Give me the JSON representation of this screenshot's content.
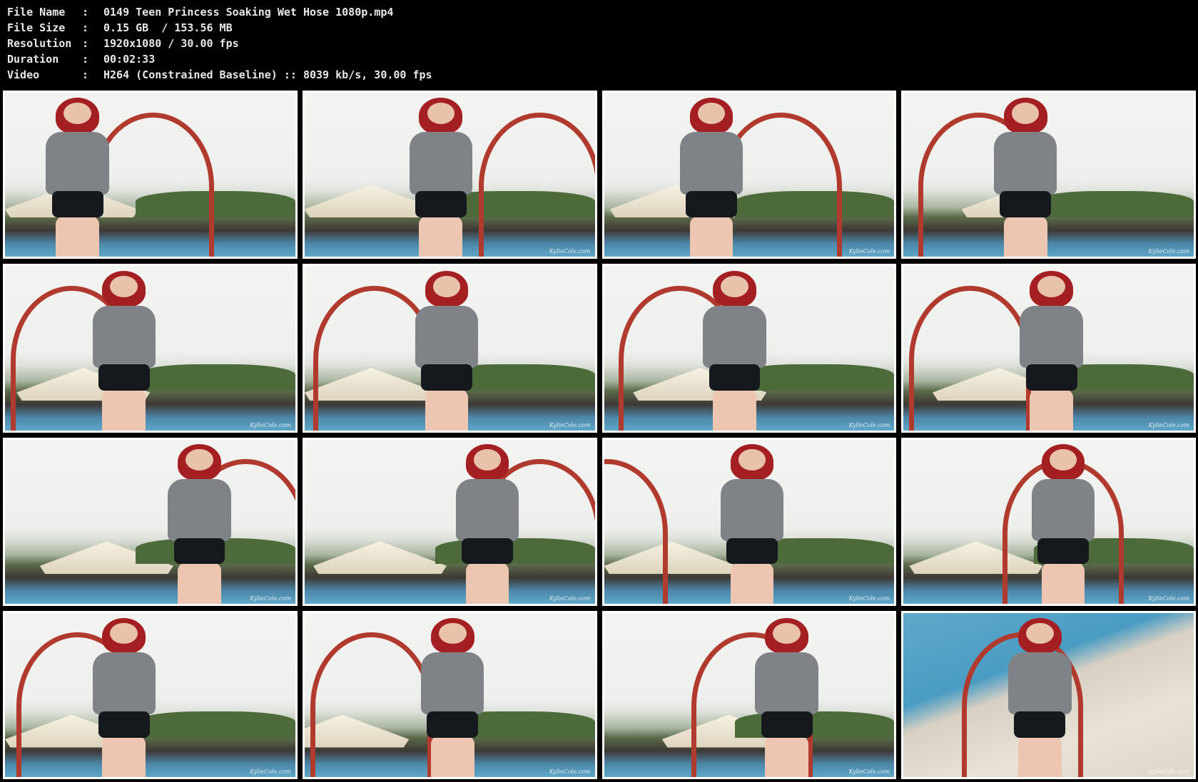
{
  "info": {
    "separator": ":",
    "rows": [
      {
        "label": "File Name",
        "value": "0149 Teen Princess Soaking Wet Hose 1080p.mp4"
      },
      {
        "label": "File Size",
        "value": "0.15 GB  / 153.56 MB"
      },
      {
        "label": "Resolution",
        "value": "1920x1080 / 30.00 fps"
      },
      {
        "label": "Duration",
        "value": "00:02:33"
      },
      {
        "label": "Video",
        "value": "H264 (Constrained Baseline) :: 8039 kb/s, 30.00 fps"
      }
    ]
  },
  "thumbnails": {
    "watermark": "KylieCole.com",
    "count": 16
  },
  "colors": {
    "background": "#000000",
    "text": "#e8e8e8",
    "frame_border": "#ffffff",
    "hair": "#a41f22",
    "hose": "#b03a2e",
    "shirt": "#7f8287",
    "pool": "#4c86a8"
  }
}
